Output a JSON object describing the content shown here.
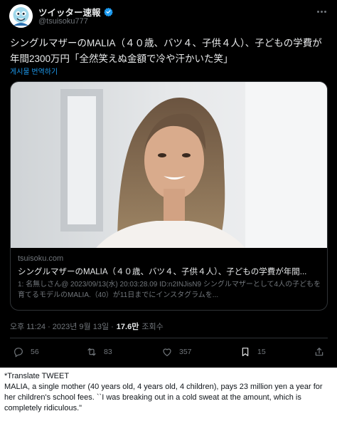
{
  "tweet": {
    "author_name": "ツイッター速報",
    "author_handle": "@tsuisoku777",
    "text": "シングルマザーのMALIA（４０歳、バツ４、子供４人）、子どもの学費が年間2300万円「全然笑えぬ金額で冷や汗かいた笑」",
    "translate_label": "게시물 번역하기",
    "card": {
      "domain": "tsuisoku.com",
      "title": "シングルマザーのMALIA（４０歳、バツ４、子供４人）、子どもの学費が年間...",
      "description": "1: 名無しさん@ 2023/09/13(水) 20:03:28.09 ID:n2INJisN9 シングルマザーとして4人の子どもを育てるモデルのMALIA.（40）が11日までにインスタグラムを..."
    },
    "time": "오후 11:24 · 2023년 9월 13일 ·",
    "views_count": "17.6만",
    "views_label": "조회수",
    "actions": {
      "reply_count": "56",
      "retweet_count": "83",
      "like_count": "357",
      "bookmark_count": "15"
    }
  },
  "translation": {
    "heading": "*Translate TWEET",
    "body": "MALIA, a single mother (40 years old, 4 years old, 4 children), pays 23 million yen a year for her children's school fees. ``I was breaking out in a cold sweat at the amount, which is completely ridiculous.\""
  },
  "icons": {
    "verified": "verified-badge-icon",
    "more": "more-icon",
    "reply": "reply-icon",
    "retweet": "retweet-icon",
    "like": "heart-icon",
    "bookmark": "bookmark-icon",
    "share": "share-icon"
  },
  "colors": {
    "background": "#000000",
    "text": "#e7e9ea",
    "muted": "#71767b",
    "link": "#1d9bf0",
    "border": "#2f3336"
  }
}
